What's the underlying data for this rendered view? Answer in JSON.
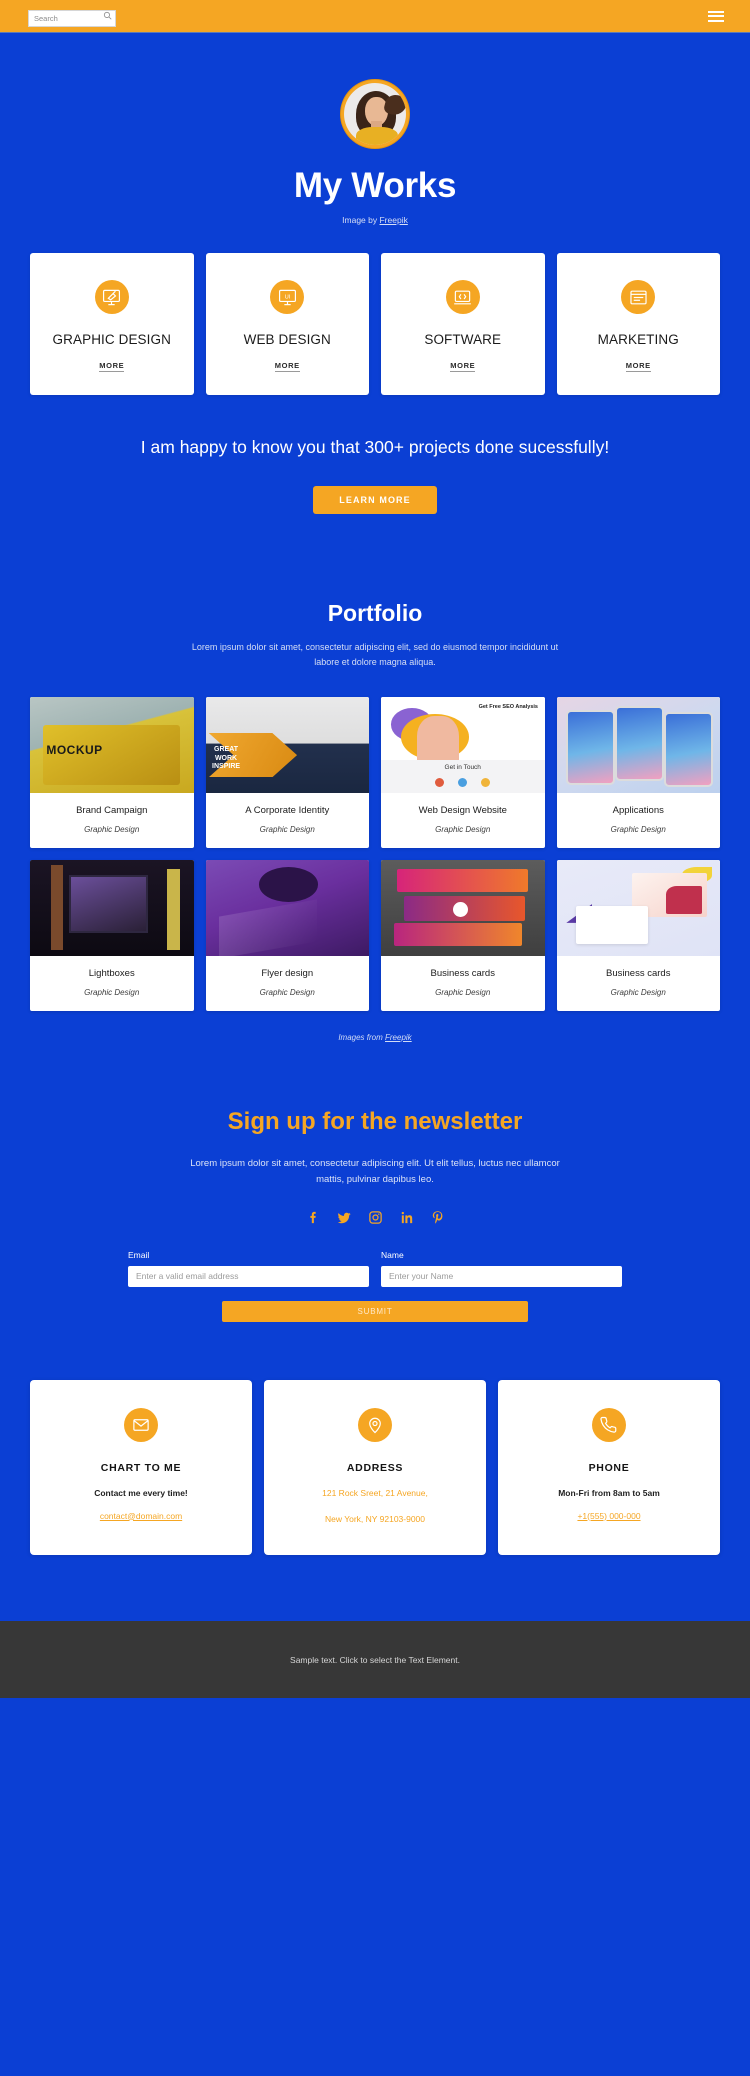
{
  "colors": {
    "brand_blue": "#0b3fd4",
    "accent_orange": "#f5a623",
    "footer_gray": "#373737",
    "card_white": "#ffffff"
  },
  "header": {
    "search_placeholder": "Search",
    "search_value": "",
    "search_icon": "search-icon",
    "menu_icon": "hamburger-menu-icon"
  },
  "hero": {
    "avatar_alt": "portrait photo of a smiling woman",
    "title": "My Works",
    "credit_prefix": "Image by ",
    "credit_link": "Freepik"
  },
  "services": [
    {
      "icon": "graphic-design-icon",
      "title": "GRAPHIC DESIGN",
      "more": "MORE"
    },
    {
      "icon": "web-design-ui-icon",
      "title": "WEB DESIGN",
      "more": "MORE"
    },
    {
      "icon": "software-code-icon",
      "title": "SOFTWARE",
      "more": "MORE"
    },
    {
      "icon": "marketing-icon",
      "title": "MARKETING",
      "more": "MORE"
    }
  ],
  "cta": {
    "text": "I am happy to know you that 300+ projects done sucessfully!",
    "button": "LEARN MORE"
  },
  "portfolio": {
    "title": "Portfolio",
    "subtitle": "Lorem ipsum dolor sit amet, consectetur adipiscing elit, sed do eiusmod tempor incididunt ut labore et dolore magna aliqua.",
    "items": [
      {
        "name": "Brand Campaign",
        "category": "Graphic Design"
      },
      {
        "name": "A Corporate Identity",
        "category": "Graphic Design"
      },
      {
        "name": "Web Design Website",
        "category": "Graphic Design"
      },
      {
        "name": "Applications",
        "category": "Graphic Design"
      },
      {
        "name": "Lightboxes",
        "category": "Graphic Design"
      },
      {
        "name": "Flyer design",
        "category": "Graphic Design"
      },
      {
        "name": "Business cards",
        "category": "Graphic Design"
      },
      {
        "name": "Business cards",
        "category": "Graphic Design"
      }
    ],
    "credit_prefix": "Images from ",
    "credit_link": "Freepik"
  },
  "newsletter": {
    "title": "Sign up for the newsletter",
    "subtitle": "Lorem ipsum dolor sit amet, consectetur adipiscing elit. Ut elit tellus, luctus nec ullamcor mattis, pulvinar dapibus leo.",
    "socials": [
      {
        "icon": "facebook-icon",
        "label": "Facebook"
      },
      {
        "icon": "twitter-icon",
        "label": "Twitter"
      },
      {
        "icon": "instagram-icon",
        "label": "Instagram"
      },
      {
        "icon": "linkedin-icon",
        "label": "LinkedIn"
      },
      {
        "icon": "pinterest-icon",
        "label": "Pinterest"
      }
    ],
    "email_label": "Email",
    "email_placeholder": "Enter a valid email address",
    "email_value": "",
    "name_label": "Name",
    "name_placeholder": "Enter your Name",
    "name_value": "",
    "submit": "SUBMIT"
  },
  "contacts": [
    {
      "icon": "envelope-icon",
      "title": "CHART TO ME",
      "line1": "Contact me every time!",
      "link": "contact@domain.com",
      "accent_lines": false
    },
    {
      "icon": "location-pin-icon",
      "title": "ADDRESS",
      "line1": "121 Rock Sreet, 21 Avenue,",
      "line2": "New York, NY 92103-9000",
      "accent_lines": true
    },
    {
      "icon": "phone-icon",
      "title": "PHONE",
      "line1": "Mon-Fri from 8am to 5am",
      "link": "+1(555) 000-000",
      "accent_lines": false
    }
  ],
  "footer": {
    "text": "Sample text. Click to select the Text Element."
  }
}
